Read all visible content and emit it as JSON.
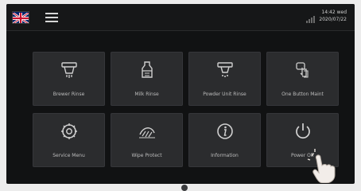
{
  "status_bar": {
    "language_flag": "uk-flag-icon",
    "menu_icon": "hamburger-menu-icon",
    "signal_icon": "signal-icon",
    "time": "14:42 wed",
    "date": "2020/07/22"
  },
  "tiles": [
    {
      "label": "Brewer Rinse",
      "icon": "brewer-rinse-icon"
    },
    {
      "label": "Milk Rinse",
      "icon": "milk-rinse-icon"
    },
    {
      "label": "Powder Unit Rinse",
      "icon": "powder-unit-rinse-icon"
    },
    {
      "label": "One Button Maint",
      "icon": "one-button-maint-icon"
    },
    {
      "label": "Service Menu",
      "icon": "gear-icon"
    },
    {
      "label": "Wipe Protect",
      "icon": "wipe-protect-icon"
    },
    {
      "label": "Information",
      "icon": "info-icon"
    },
    {
      "label": "Power Off",
      "icon": "power-icon"
    }
  ]
}
